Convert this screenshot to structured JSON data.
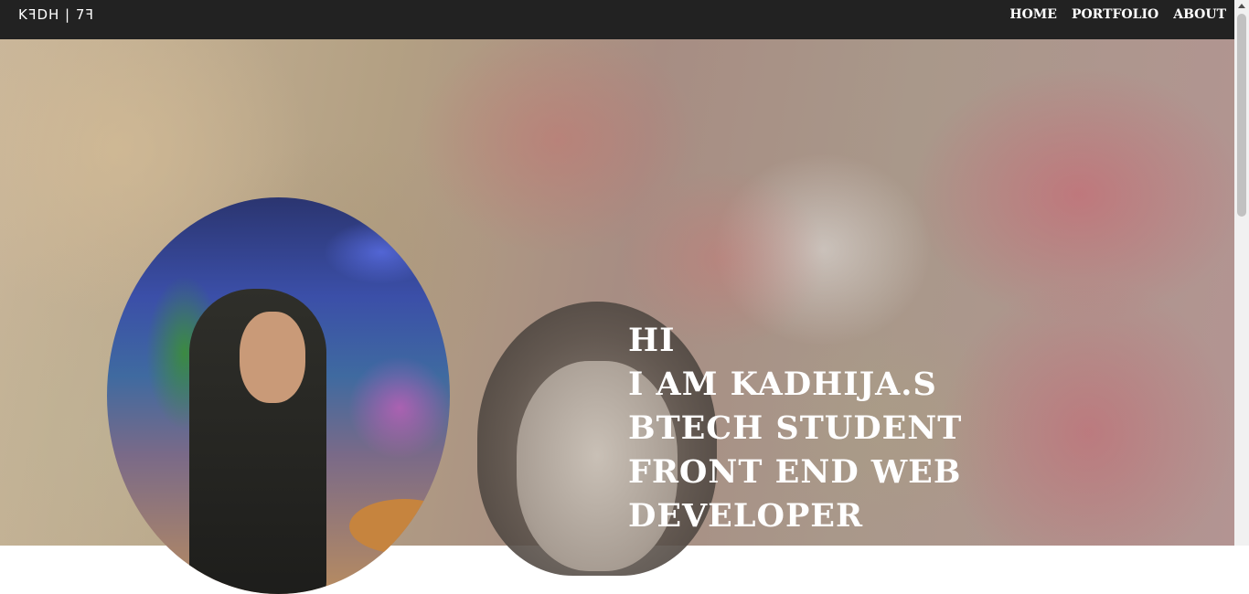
{
  "navbar": {
    "logo": "KꟻDH | 7ꟻ",
    "links": [
      "HOME",
      "PORTFOLIO",
      "ABOUT"
    ]
  },
  "hero": {
    "lines": [
      "HI",
      "I AM KADHIJA.S",
      "BTECH STUDENT",
      "FRONT END WEB",
      "DEVELOPER"
    ]
  },
  "icons": {
    "scroll_up": "scroll-up-arrow-icon"
  }
}
